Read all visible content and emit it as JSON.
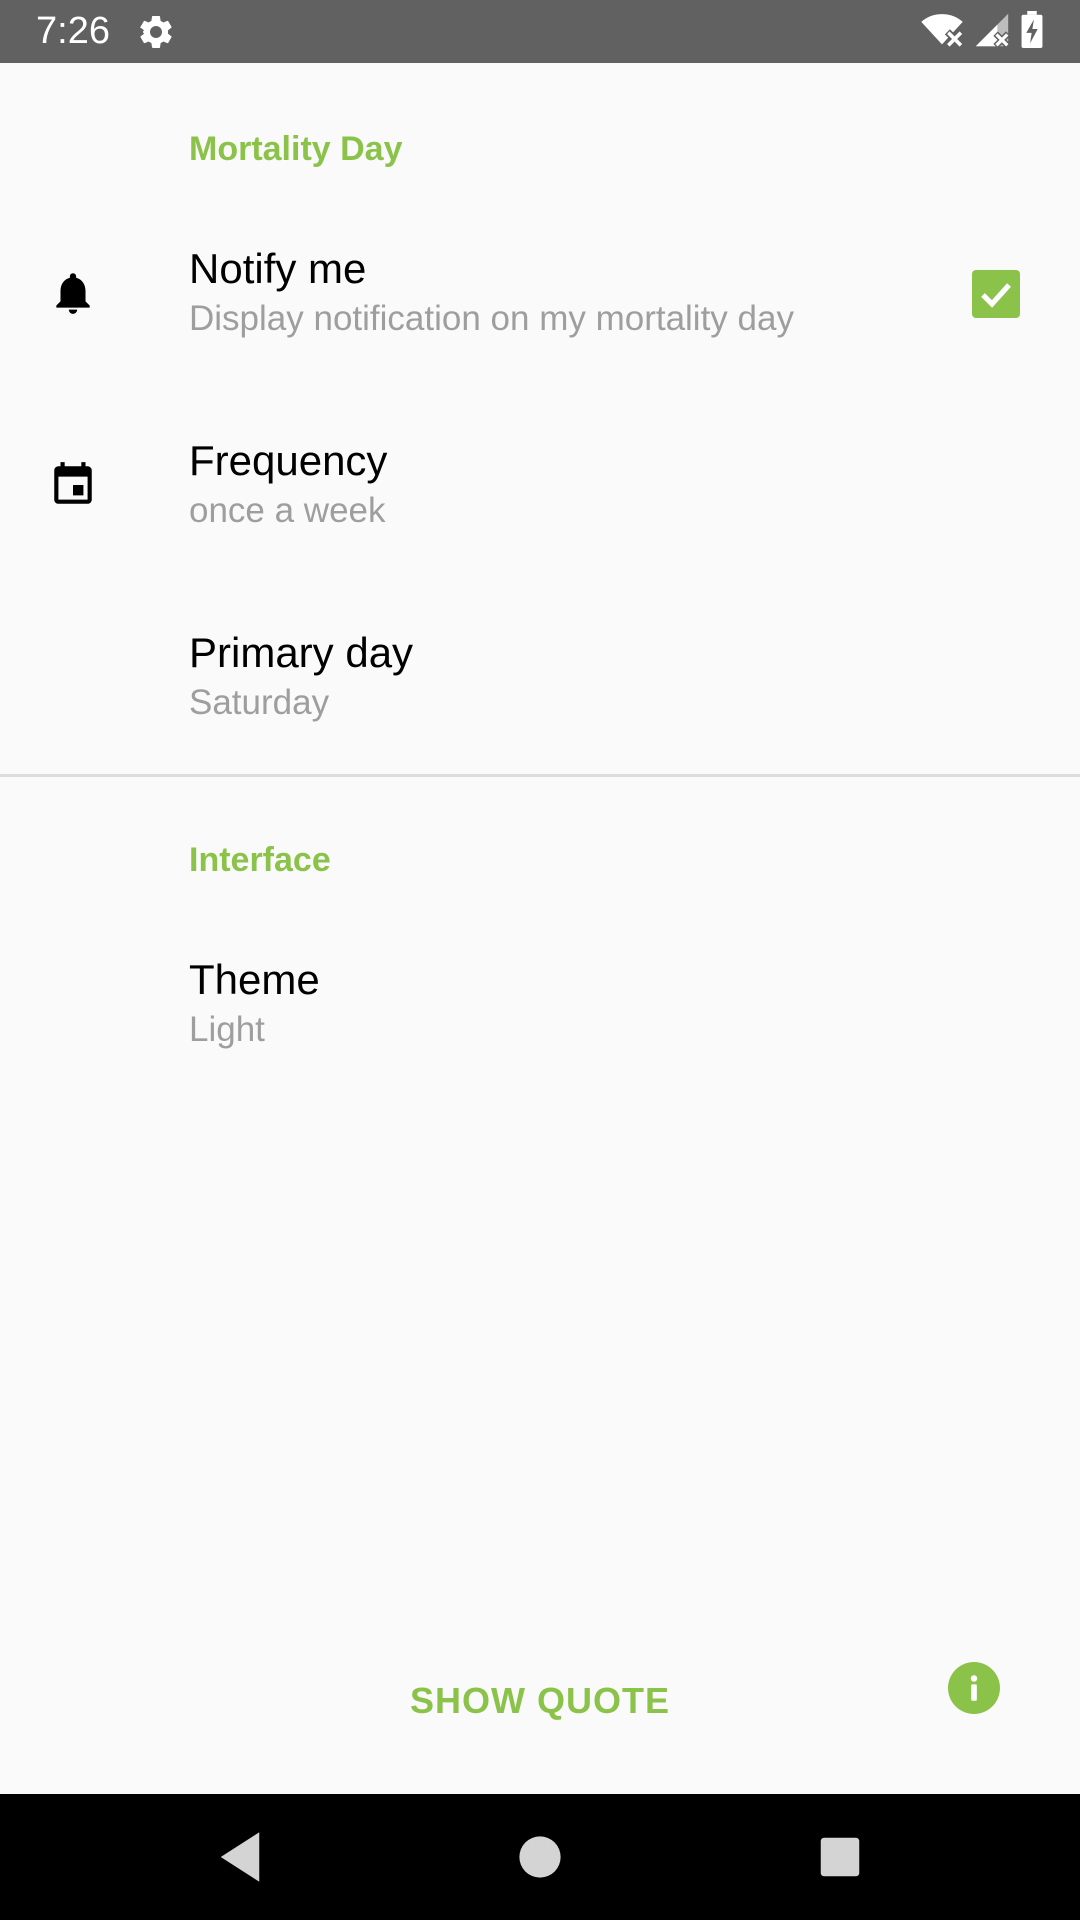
{
  "status_bar": {
    "time": "7:26",
    "icons": [
      "gear-icon",
      "wifi-off-icon",
      "signal-off-icon",
      "battery-charging-icon"
    ]
  },
  "sections": {
    "mortality": {
      "title": "Mortality Day",
      "notify": {
        "title": "Notify me",
        "summary": "Display notification on my mortality day",
        "icon": "bell-icon",
        "checked": true
      },
      "frequency": {
        "title": "Frequency",
        "summary": "once a week",
        "icon": "calendar-icon"
      },
      "primary_day": {
        "title": "Primary day",
        "summary": "Saturday"
      }
    },
    "interface": {
      "title": "Interface",
      "theme": {
        "title": "Theme",
        "summary": "Light"
      }
    }
  },
  "footer": {
    "show_quote_label": "SHOW QUOTE",
    "info_icon": "info-icon"
  },
  "colors": {
    "accent": "#8bc34a",
    "status_bar": "#616161",
    "summary_text": "#9e9e9e",
    "background": "#fafafa",
    "nav_bar": "#000000"
  }
}
